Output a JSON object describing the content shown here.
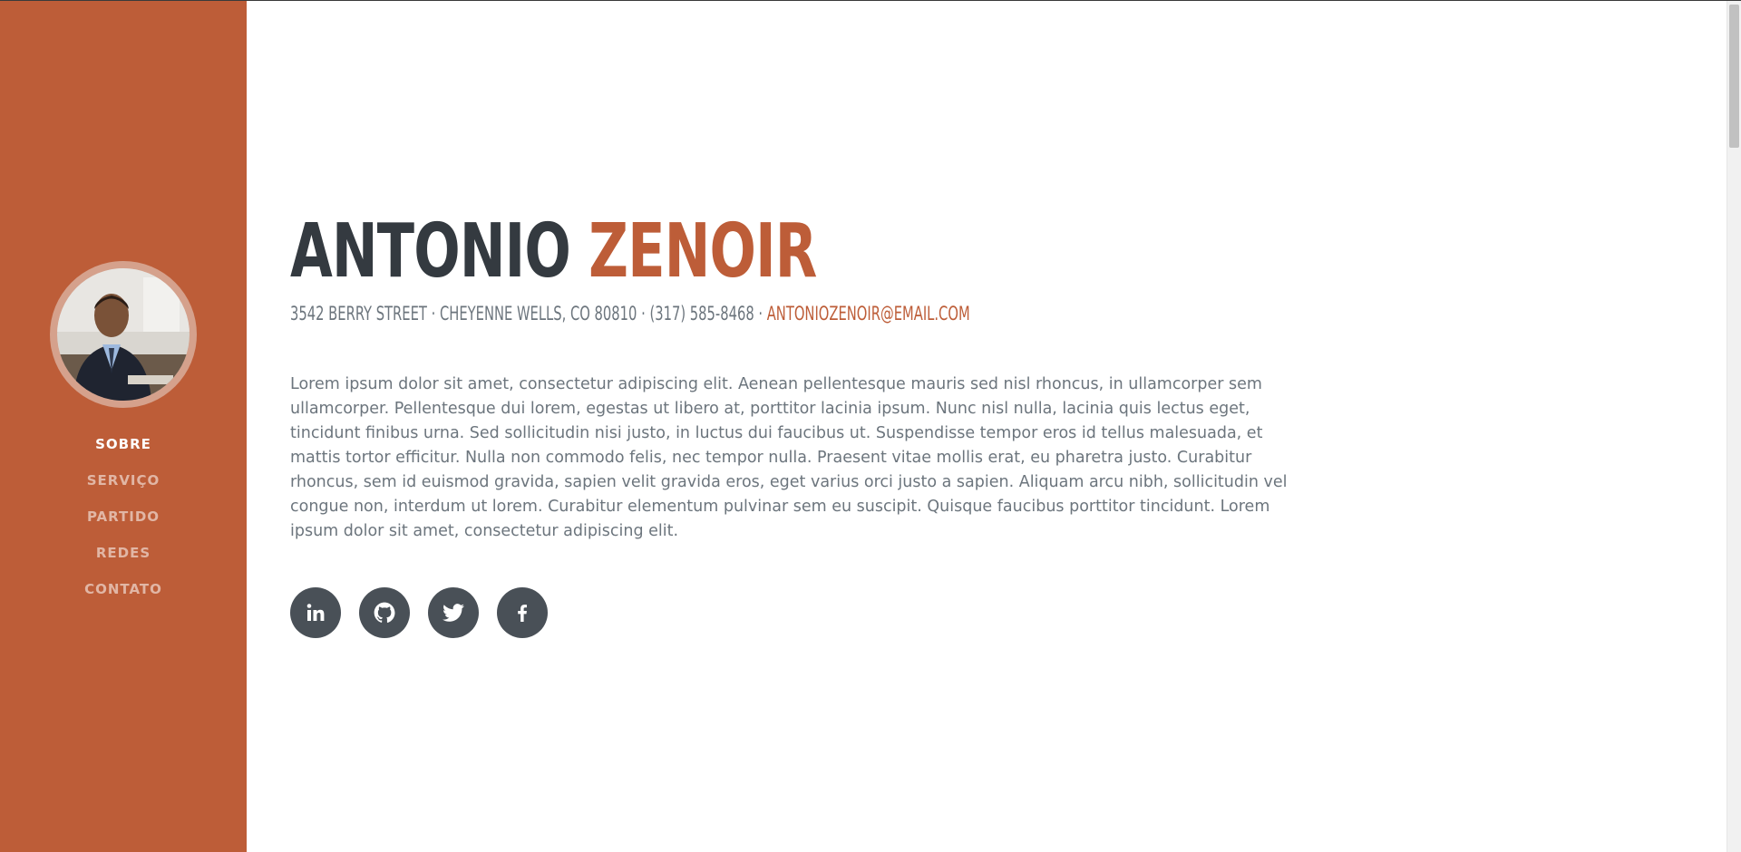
{
  "profile": {
    "first_name": "ANTONIO",
    "last_name": "ZENOIR",
    "address": "3542 BERRY STREET · CHEYENNE WELLS, CO 80810 · (317) 585-8468 ·",
    "email": "ANTONIOZENOIR@EMAIL.COM",
    "bio": "Lorem ipsum dolor sit amet, consectetur adipiscing elit. Aenean pellentesque mauris sed nisl rhoncus, in ullamcorper sem ullamcorper. Pellentesque dui lorem, egestas ut libero at, porttitor lacinia ipsum. Nunc nisl nulla, lacinia quis lectus eget, tincidunt finibus urna. Sed sollicitudin nisi justo, in luctus dui faucibus ut. Suspendisse tempor eros id tellus malesuada, et mattis tortor efficitur. Nulla non commodo felis, nec tempor nulla. Praesent vitae mollis erat, eu pharetra justo. Curabitur rhoncus, sem id euismod gravida, sapien velit gravida eros, eget varius orci justo a sapien. Aliquam arcu nibh, sollicitudin vel congue non, interdum ut lorem. Curabitur elementum pulvinar sem eu suscipit. Quisque faucibus porttitor tincidunt. Lorem ipsum dolor sit amet, consectetur adipiscing elit."
  },
  "sidebar": {
    "nav": [
      {
        "label": "SOBRE",
        "active": true
      },
      {
        "label": "SERVIÇO",
        "active": false
      },
      {
        "label": "PARTIDO",
        "active": false
      },
      {
        "label": "REDES",
        "active": false
      },
      {
        "label": "CONTATO",
        "active": false
      }
    ]
  },
  "social": [
    {
      "icon": "linkedin-icon"
    },
    {
      "icon": "github-icon"
    },
    {
      "icon": "twitter-icon"
    },
    {
      "icon": "facebook-icon"
    }
  ],
  "colors": {
    "primary": "#bd5d38",
    "heading": "#343a40",
    "muted": "#6c757d",
    "social_bg": "#495057"
  }
}
